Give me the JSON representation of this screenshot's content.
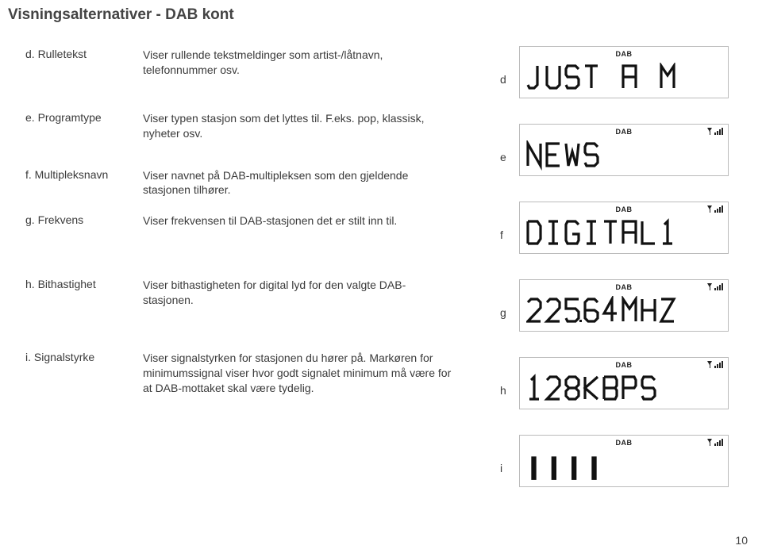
{
  "title": "Visningsalternativer - DAB kont",
  "rows": [
    {
      "label": "d. Rulletekst",
      "desc": "Viser rullende tekstmeldinger som artist-/låtnavn, telefonnummer osv."
    },
    {
      "label": "e. Programtype",
      "desc": "Viser typen stasjon som det lyttes til. F.eks. pop, klassisk, nyheter osv."
    },
    {
      "label": "f. Multipleksnavn",
      "desc": "Viser navnet på DAB-multipleksen som den gjeldende stasjonen tilhører."
    },
    {
      "label": "g. Frekvens",
      "desc": "Viser frekvensen til DAB-stasjonen det er stilt inn til."
    },
    {
      "label": "h. Bithastighet",
      "desc": "Viser bithastigheten for digital lyd for den valgte DAB-stasjonen."
    },
    {
      "label": "i. Signalstyrke",
      "desc": "Viser signalstyrken for stasjonen du hører på. Markøren for minimumssignal viser hvor godt signalet minimum må være for at DAB-mottaket skal være tydelig."
    }
  ],
  "displays": [
    {
      "marker": "d",
      "dab": "DAB",
      "signal": false,
      "text": "JUST A M"
    },
    {
      "marker": "e",
      "dab": "DAB",
      "signal": true,
      "text": "NEWS"
    },
    {
      "marker": "f",
      "dab": "DAB",
      "signal": true,
      "text": "DIGITAL1"
    },
    {
      "marker": "g",
      "dab": "DAB",
      "signal": true,
      "text": "225.64MHZ"
    },
    {
      "marker": "h",
      "dab": "DAB",
      "signal": true,
      "text": "128KBPS"
    },
    {
      "marker": "i",
      "dab": "DAB",
      "signal": true,
      "bars": [
        14,
        14,
        14,
        14,
        0,
        0,
        0,
        0,
        0
      ]
    }
  ],
  "page": "10"
}
